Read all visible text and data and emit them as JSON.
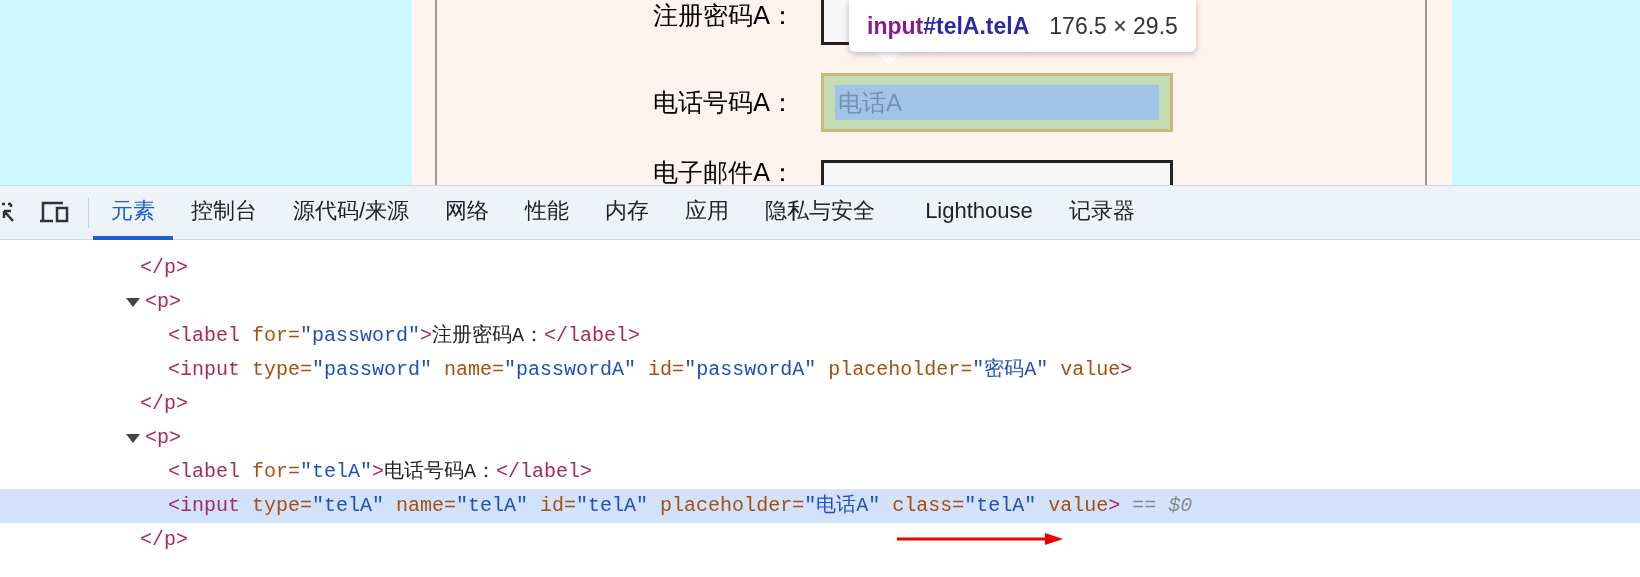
{
  "page": {
    "rows": [
      {
        "label": "注册密码A：",
        "kind": "plain"
      },
      {
        "label": "电话号码A：",
        "kind": "inspected",
        "placeholder": "电话A"
      },
      {
        "label": "电子邮件A：",
        "kind": "plain"
      }
    ]
  },
  "tooltip": {
    "tag": "input",
    "selector": "#telA.telA",
    "size": "176.5 × 29.5"
  },
  "devtools": {
    "tabs": [
      {
        "label": "元素",
        "selected": true
      },
      {
        "label": "控制台",
        "selected": false
      },
      {
        "label": "源代码/来源",
        "selected": false
      },
      {
        "label": "网络",
        "selected": false
      },
      {
        "label": "性能",
        "selected": false
      },
      {
        "label": "内存",
        "selected": false
      },
      {
        "label": "应用",
        "selected": false
      },
      {
        "label": "隐私与安全",
        "selected": false
      },
      {
        "label": "Lighthouse",
        "selected": false
      },
      {
        "label": "记录器",
        "selected": false
      }
    ],
    "dom": [
      {
        "kind": "close",
        "tokens": [
          {
            "kind": "tag",
            "text": "</p>"
          }
        ]
      },
      {
        "kind": "element",
        "expanded": true,
        "tokens": [
          {
            "kind": "tag",
            "text": "<p>"
          }
        ],
        "children": [
          {
            "selected": false,
            "tokens": [
              {
                "kind": "tag",
                "text": "<label "
              },
              {
                "kind": "attr",
                "text": "for="
              },
              {
                "kind": "value",
                "text": "\"password\""
              },
              {
                "kind": "tag",
                "text": ">"
              },
              {
                "kind": "text",
                "text": "注册密码A："
              },
              {
                "kind": "tag",
                "text": "</label>"
              }
            ]
          },
          {
            "selected": false,
            "tokens": [
              {
                "kind": "tag",
                "text": "<input "
              },
              {
                "kind": "attr",
                "text": "type="
              },
              {
                "kind": "value",
                "text": "\"password\" "
              },
              {
                "kind": "attr",
                "text": "name="
              },
              {
                "kind": "value",
                "text": "\"passwordA\" "
              },
              {
                "kind": "attr",
                "text": "id="
              },
              {
                "kind": "value",
                "text": "\"passwordA\" "
              },
              {
                "kind": "attr",
                "text": "placeholder="
              },
              {
                "kind": "value",
                "text": "\"密码A\" "
              },
              {
                "kind": "attr",
                "text": "value"
              },
              {
                "kind": "tag",
                "text": ">"
              }
            ]
          }
        ],
        "close": "</p>"
      },
      {
        "kind": "element",
        "expanded": true,
        "tokens": [
          {
            "kind": "tag",
            "text": "<p>"
          }
        ],
        "children": [
          {
            "selected": false,
            "tokens": [
              {
                "kind": "tag",
                "text": "<label "
              },
              {
                "kind": "attr",
                "text": "for="
              },
              {
                "kind": "value",
                "text": "\"telA\""
              },
              {
                "kind": "tag",
                "text": ">"
              },
              {
                "kind": "text",
                "text": "电话号码A："
              },
              {
                "kind": "tag",
                "text": "</label>"
              }
            ]
          },
          {
            "selected": true,
            "tokens": [
              {
                "kind": "tag",
                "text": "<input "
              },
              {
                "kind": "attr",
                "text": "type="
              },
              {
                "kind": "value",
                "text": "\"telA\" "
              },
              {
                "kind": "attr",
                "text": "name="
              },
              {
                "kind": "value",
                "text": "\"telA\" "
              },
              {
                "kind": "attr",
                "text": "id="
              },
              {
                "kind": "value",
                "text": "\"telA\" "
              },
              {
                "kind": "attr",
                "text": "placeholder="
              },
              {
                "kind": "value",
                "text": "\"电话A\" "
              },
              {
                "kind": "attr",
                "text": "class="
              },
              {
                "kind": "value",
                "text": "\"telA\" "
              },
              {
                "kind": "attr",
                "text": "value"
              },
              {
                "kind": "tag",
                "text": ">"
              },
              {
                "kind": "hint",
                "text": "== $0"
              }
            ]
          }
        ],
        "close": "</p>"
      }
    ]
  }
}
